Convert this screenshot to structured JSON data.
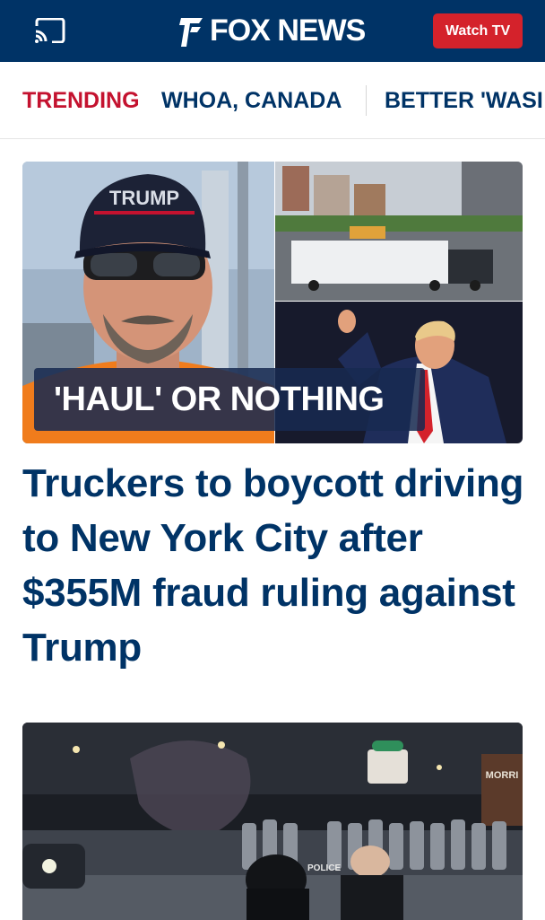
{
  "header": {
    "logo_text": "FOX NEWS",
    "watch_label": "Watch TV",
    "brand_color": "#003366",
    "accent_color": "#d4222b",
    "cast_icon": "cast-icon"
  },
  "trending": {
    "label": "TRENDING",
    "items": [
      "WHOA, CANADA",
      "BETTER 'WASI"
    ]
  },
  "hero": {
    "kicker": "'HAUL' OR NOTHING",
    "cap_text": "TRUMP",
    "headline": "Truckers to boycott driving to New York City after $355M fraud ruling against Trump"
  },
  "second_story": {
    "sign_text": "MORRI",
    "police_text": "POLICE"
  }
}
